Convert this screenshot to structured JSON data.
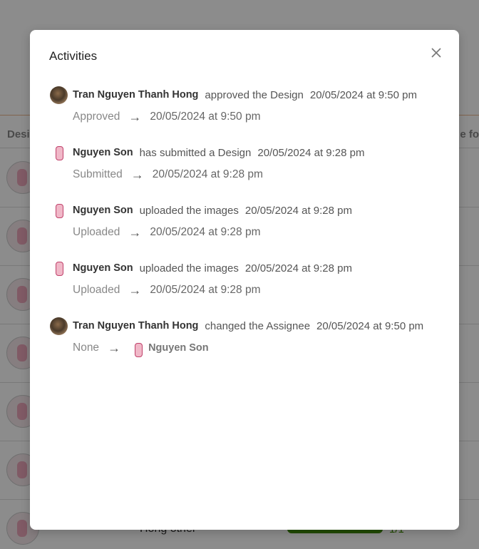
{
  "background": {
    "column_header_left": "Desi",
    "column_header_right": "e fo",
    "row_text": "Hong other",
    "progress_fraction": "1/1",
    "progress": 1.0
  },
  "modal": {
    "title": "Activities",
    "close_icon": "close-icon",
    "activities": [
      {
        "user": "Tran Nguyen Thanh Hong",
        "avatar": "photo",
        "action": "approved the Design",
        "time": "20/05/2024 at 9:50 pm",
        "from": "Approved",
        "to": "20/05/2024 at 9:50 pm"
      },
      {
        "user": "Nguyen Son",
        "avatar": "unicorn",
        "action": "has submitted a Design",
        "time": "20/05/2024 at 9:28 pm",
        "from": "Submitted",
        "to": "20/05/2024 at 9:28 pm"
      },
      {
        "user": "Nguyen Son",
        "avatar": "unicorn",
        "action": "uploaded the images",
        "time": "20/05/2024 at 9:28 pm",
        "from": "Uploaded",
        "to": "20/05/2024 at 9:28 pm"
      },
      {
        "user": "Nguyen Son",
        "avatar": "unicorn",
        "action": "uploaded the images",
        "time": "20/05/2024 at 9:28 pm",
        "from": "Uploaded",
        "to": "20/05/2024 at 9:28 pm"
      },
      {
        "user": "Tran Nguyen Thanh Hong",
        "avatar": "photo",
        "action": "changed the Assignee",
        "time": "20/05/2024 at 9:50 pm",
        "from": "None",
        "to_user": "Nguyen Son"
      }
    ]
  }
}
